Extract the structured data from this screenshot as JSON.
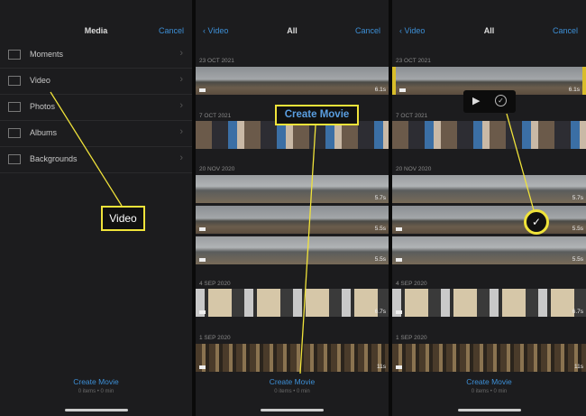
{
  "media": {
    "title": "Media",
    "cancel": "Cancel",
    "items": [
      {
        "label": "Moments",
        "icon": "moments-icon"
      },
      {
        "label": "Video",
        "icon": "film-icon"
      },
      {
        "label": "Photos",
        "icon": "photo-icon"
      },
      {
        "label": "Albums",
        "icon": "album-icon"
      },
      {
        "label": "Backgrounds",
        "icon": "image-icon"
      }
    ],
    "create": "Create Movie",
    "sub": "0 items • 0 min"
  },
  "video": {
    "back": "Video",
    "title": "All",
    "cancel": "Cancel",
    "sections": [
      {
        "date": "23 OCT 2021",
        "clips": [
          "6.1s"
        ]
      },
      {
        "date": "7 OCT 2021",
        "clips": [
          ""
        ]
      },
      {
        "date": "20 NOV 2020",
        "clips": [
          "5.7s",
          "5.5s",
          "5.5s"
        ]
      },
      {
        "date": "4 SEP 2020",
        "clips": [
          "6.7s"
        ]
      },
      {
        "date": "1 SEP 2020",
        "clips": [
          "11s"
        ]
      }
    ],
    "create": "Create Movie",
    "sub": "0 items • 0 min"
  },
  "callouts": {
    "video": "Video",
    "create": "Create Movie"
  },
  "popup": {
    "play": "▶",
    "check": "✓"
  },
  "accent": "#3d8fd6",
  "highlight": "#f0e33a"
}
